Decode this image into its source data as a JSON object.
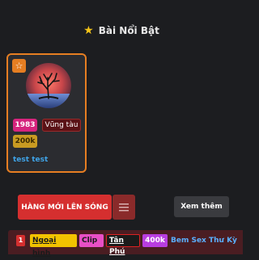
{
  "section": {
    "title": "Bài Nổi Bật",
    "icon": "star-icon",
    "icon_color": "#f5c518"
  },
  "card": {
    "favorite_icon": "star-outline-icon",
    "tags": {
      "year": "1983",
      "place": "Vũng tàu",
      "price": "200k"
    },
    "title": "test test"
  },
  "toolbar": {
    "new_label": "HÀNG MỚI LÊN SÓNG",
    "menu_icon": "hamburger-menu-icon",
    "more_label": "Xem thêm"
  },
  "list": {
    "items": [
      {
        "rank": "1",
        "chips": [
          "Ngoại hình",
          "Clip",
          "Tân Phú",
          "400k"
        ],
        "title": "Bem Sex Thư Kỳ"
      }
    ]
  },
  "colors": {
    "accent_orange": "#e67e22",
    "accent_red": "#d52f2f",
    "link_blue": "#3fa4e8",
    "background": "#1c1d20"
  }
}
